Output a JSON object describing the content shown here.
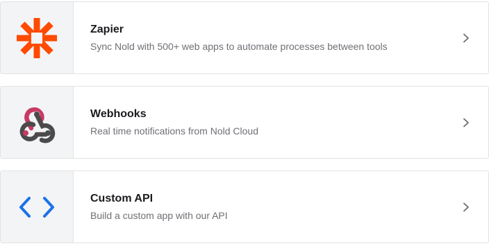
{
  "integrations": [
    {
      "icon": "zapier-logo-icon",
      "title": "Zapier",
      "description": "Sync Nold with 500+ web apps to automate processes between tools"
    },
    {
      "icon": "webhooks-logo-icon",
      "title": "Webhooks",
      "description": "Real time notifications from Nold Cloud"
    },
    {
      "icon": "code-brackets-icon",
      "title": "Custom API",
      "description": "Build a custom app with our API"
    }
  ],
  "colors": {
    "zapier": "#ff4a00",
    "webhooks_pink": "#c73a63",
    "webhooks_dark": "#4b4b4b",
    "api_blue": "#1a73e8",
    "chevron": "#6b6b72"
  }
}
